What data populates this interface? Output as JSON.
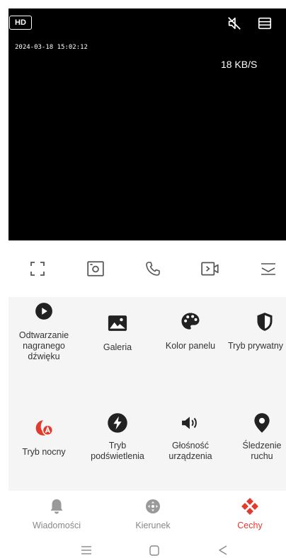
{
  "video": {
    "quality_label": "HD",
    "timestamp": "2024-03-18 15:02:12",
    "speed": "18 KB/S"
  },
  "toolbar": {
    "icons": [
      "fullscreen-icon",
      "snapshot-icon",
      "phone-icon",
      "record-icon",
      "collapse-icon"
    ]
  },
  "features": [
    {
      "label": "Odtwarzanie nagranego dźwięku",
      "icon": "play-icon"
    },
    {
      "label": "Galeria",
      "icon": "gallery-icon"
    },
    {
      "label": "Kolor panelu",
      "icon": "palette-icon"
    },
    {
      "label": "Tryb prywatny",
      "icon": "privacy-icon"
    },
    {
      "label": "Tryb nocny",
      "icon": "night-mode-icon",
      "color": "#e33a2e"
    },
    {
      "label": "Tryb podświetlenia",
      "icon": "flash-icon"
    },
    {
      "label": "Głośność urządzenia",
      "icon": "volume-icon"
    },
    {
      "label": "Śledzenie ruchu",
      "icon": "location-pin-icon"
    }
  ],
  "nav": {
    "items": [
      {
        "label": "Wiadomości"
      },
      {
        "label": "Kierunek"
      },
      {
        "label": "Cechy"
      }
    ],
    "active": "Cechy"
  },
  "colors": {
    "accent": "#e33a2e",
    "icon_dark": "#222222"
  }
}
